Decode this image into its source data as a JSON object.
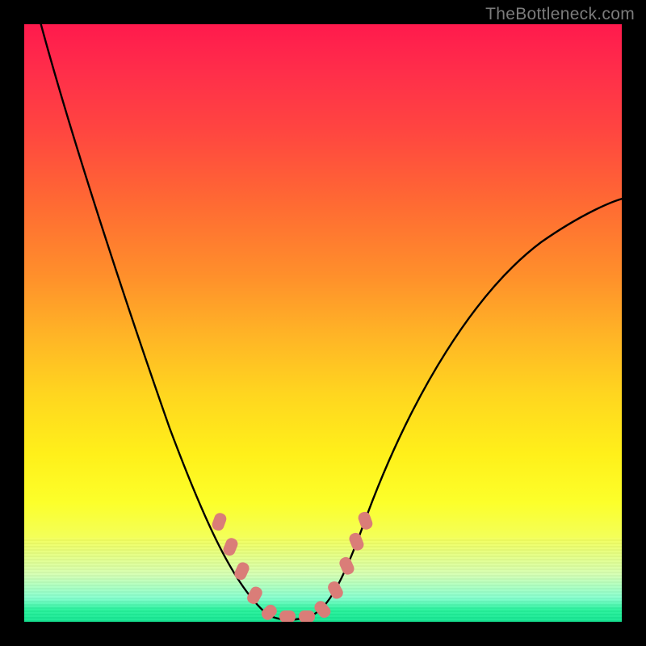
{
  "watermark": "TheBottleneck.com",
  "chart_data": {
    "type": "line",
    "title": "",
    "xlabel": "",
    "ylabel": "",
    "xlim": [
      0,
      100
    ],
    "ylim": [
      0,
      100
    ],
    "grid": false,
    "legend": false,
    "background_gradient": {
      "from": "#ff1a4d",
      "to": "#15e693",
      "direction": "top-to-bottom"
    },
    "series": [
      {
        "name": "bottleneck-curve",
        "color": "#000000",
        "x": [
          2,
          6,
          10,
          14,
          18,
          22,
          26,
          30,
          34,
          36,
          38,
          40,
          42,
          44,
          46,
          48,
          52,
          56,
          60,
          64,
          68,
          72,
          76,
          80,
          84,
          88,
          92,
          96,
          100
        ],
        "y": [
          100,
          90,
          80,
          70,
          60,
          50,
          41,
          32,
          23,
          18,
          13,
          8,
          4,
          1,
          0,
          0,
          4,
          12,
          22,
          31,
          39,
          46,
          52,
          57,
          61,
          64,
          67,
          69,
          70
        ]
      },
      {
        "name": "marker-dots",
        "color": "#da7d78",
        "type": "scatter",
        "x": [
          32,
          34,
          36,
          38,
          40,
          42,
          44,
          46,
          48,
          50,
          51,
          52,
          53
        ],
        "y": [
          18,
          14,
          10,
          6,
          3,
          1,
          0,
          0,
          1,
          3,
          6,
          10,
          14
        ]
      }
    ]
  }
}
